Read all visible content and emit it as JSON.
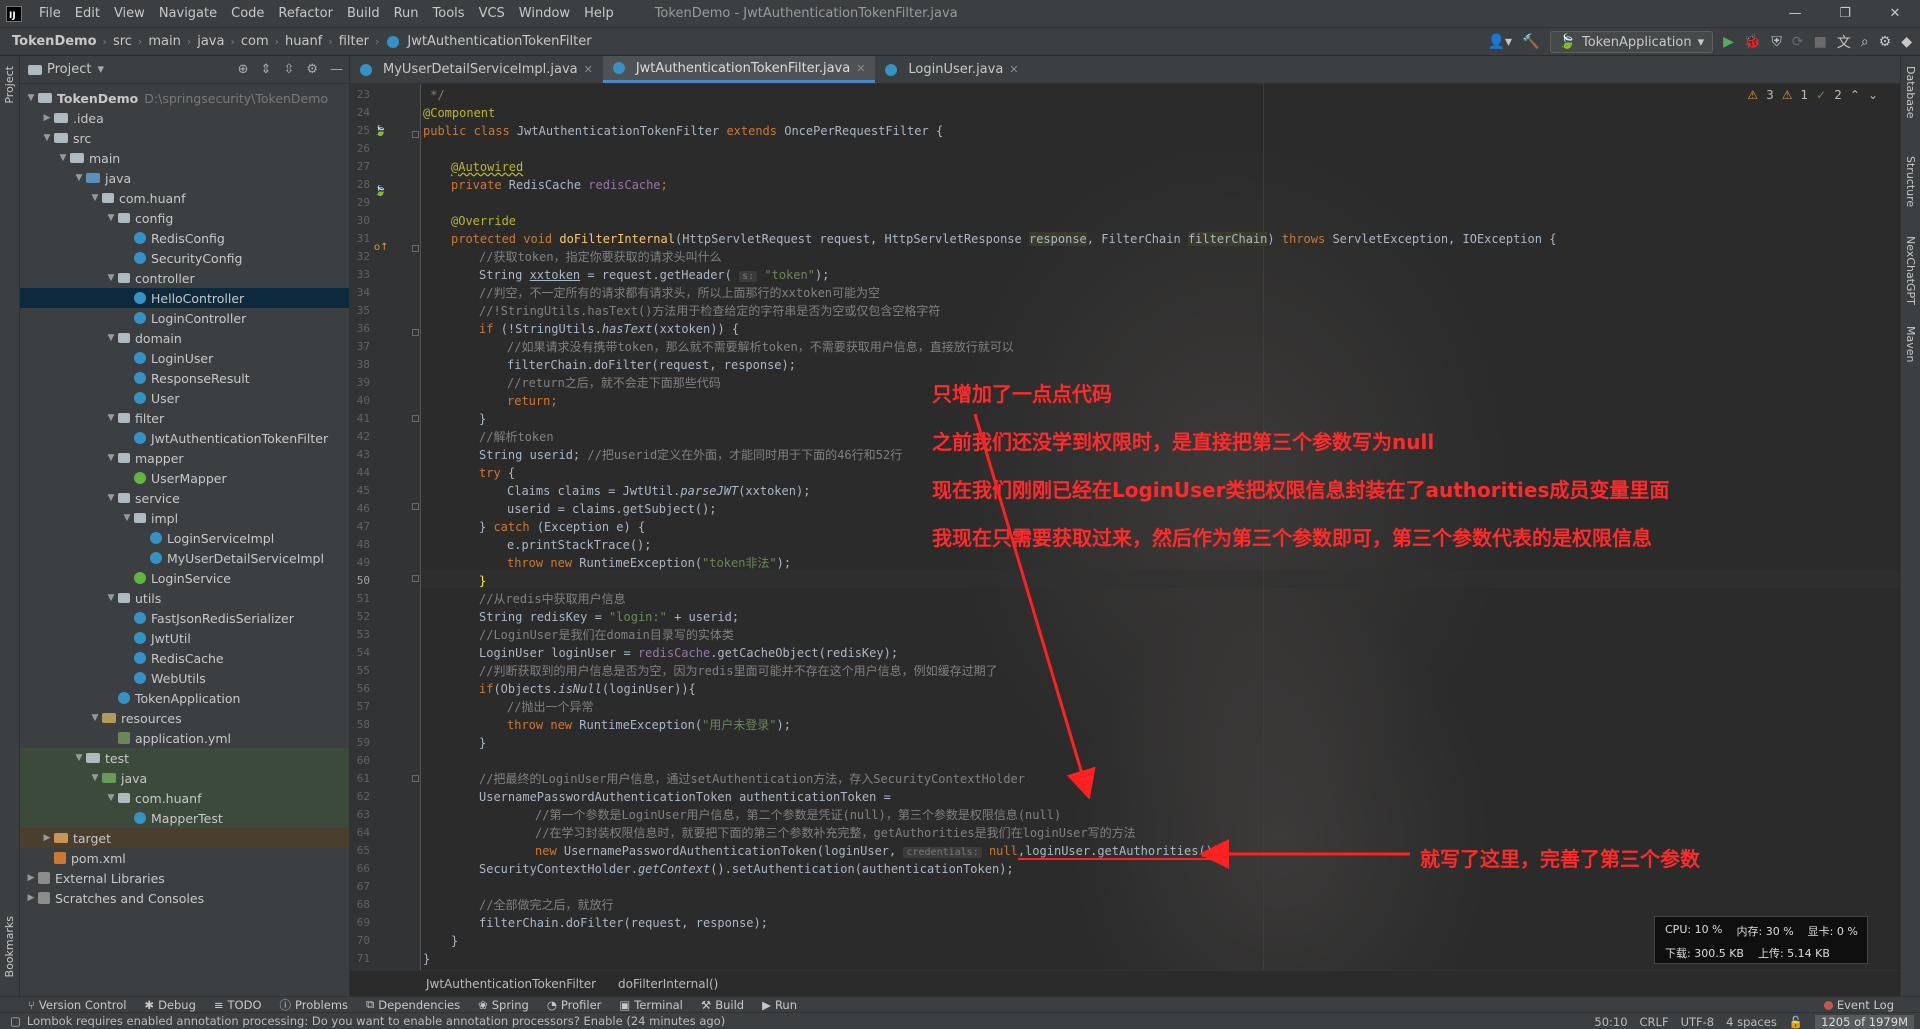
{
  "menubar": {
    "logo": "IJ",
    "items": [
      "File",
      "Edit",
      "View",
      "Navigate",
      "Code",
      "Refactor",
      "Build",
      "Run",
      "Tools",
      "VCS",
      "Window",
      "Help"
    ],
    "window_title": "TokenDemo - JwtAuthenticationTokenFilter.java",
    "controls": [
      "—",
      "❐",
      "✕"
    ]
  },
  "navbar": {
    "crumbs": [
      "TokenDemo",
      "src",
      "main",
      "java",
      "com",
      "huanf",
      "filter",
      "JwtAuthenticationTokenFilter"
    ],
    "run_config": "TokenApplication"
  },
  "left_stripe": {
    "project": "Project",
    "bookmarks": "Bookmarks"
  },
  "right_stripe": [
    "Database",
    "Structure",
    "NexChatGPT",
    "Maven"
  ],
  "project_panel": {
    "title": "Project",
    "tree": [
      {
        "label": "TokenDemo",
        "extra": "D:\\springsecurity\\TokenDemo"
      },
      {
        "label": ".idea"
      },
      {
        "label": "src"
      },
      {
        "label": "main"
      },
      {
        "label": "java"
      },
      {
        "label": "com.huanf"
      },
      {
        "label": "config"
      },
      {
        "label": "RedisConfig"
      },
      {
        "label": "SecurityConfig"
      },
      {
        "label": "controller"
      },
      {
        "label": "HelloController"
      },
      {
        "label": "LoginController"
      },
      {
        "label": "domain"
      },
      {
        "label": "LoginUser"
      },
      {
        "label": "ResponseResult"
      },
      {
        "label": "User"
      },
      {
        "label": "filter"
      },
      {
        "label": "JwtAuthenticationTokenFilter"
      },
      {
        "label": "mapper"
      },
      {
        "label": "UserMapper"
      },
      {
        "label": "service"
      },
      {
        "label": "impl"
      },
      {
        "label": "LoginServiceImpl"
      },
      {
        "label": "MyUserDetailServiceImpl"
      },
      {
        "label": "LoginService"
      },
      {
        "label": "utils"
      },
      {
        "label": "FastJsonRedisSerializer"
      },
      {
        "label": "JwtUtil"
      },
      {
        "label": "RedisCache"
      },
      {
        "label": "WebUtils"
      },
      {
        "label": "TokenApplication"
      },
      {
        "label": "resources"
      },
      {
        "label": "application.yml"
      },
      {
        "label": "test"
      },
      {
        "label": "java"
      },
      {
        "label": "com.huanf"
      },
      {
        "label": "MapperTest"
      },
      {
        "label": "target"
      },
      {
        "label": "pom.xml"
      },
      {
        "label": "External Libraries"
      },
      {
        "label": "Scratches and Consoles"
      }
    ]
  },
  "editor_tabs": [
    {
      "label": "MyUserDetailServiceImpl.java"
    },
    {
      "label": "JwtAuthenticationTokenFilter.java"
    },
    {
      "label": "LoginUser.java"
    }
  ],
  "inspections": {
    "warnings": "3",
    "weak": "1",
    "typos": "2"
  },
  "line_numbers": [
    "23",
    "24",
    "25",
    "26",
    "27",
    "28",
    "29",
    "30",
    "31",
    "32",
    "33",
    "34",
    "35",
    "36",
    "37",
    "38",
    "39",
    "40",
    "41",
    "42",
    "43",
    "44",
    "45",
    "46",
    "47",
    "48",
    "49",
    "50",
    "51",
    "52",
    "53",
    "54",
    "55",
    "56",
    "57",
    "58",
    "59",
    "60",
    "61",
    "62",
    "63",
    "64",
    "65",
    "66",
    "67",
    "68",
    "69",
    "70",
    "71"
  ],
  "code": {
    "l23": " */",
    "l24": "@Component",
    "l25_a": "public class ",
    "l25_b": "JwtAuthenticationTokenFilter ",
    "l25_c": "extends ",
    "l25_d": "OncePerRequestFilter {",
    "l27": "@Autowired",
    "l28_a": "private ",
    "l28_b": "RedisCache ",
    "l28_c": "redisCache",
    "l28_d": ";",
    "l30": "@Override",
    "l31_a": "protected void ",
    "l31_b": "doFilterInternal",
    "l31_c": "(HttpServletRequest request, HttpServletResponse ",
    "l31_d": "response",
    "l31_e": ", FilterChain ",
    "l31_f": "filterChain",
    "l31_g": ") ",
    "l31_h": "throws ",
    "l31_i": "ServletException, IOException {",
    "l32": "//获取token，指定你要获取的请求头叫什么",
    "l33_a": "String ",
    "l33_b": "xxtoken",
    "l33_c": " = request.getHeader( ",
    "l33_hint": "s:",
    "l33_d": " \"token\"",
    "l33_e": ");",
    "l34": "//判空，不一定所有的请求都有请求头，所以上面那行的xxtoken可能为空",
    "l35": "//!StringUtils.hasText()方法用于检查给定的字符串是否为空或仅包含空格字符",
    "l36_a": "if ",
    "l36_b": "(!StringUtils.",
    "l36_c": "hasText",
    "l36_d": "(xxtoken)) {",
    "l37": "//如果请求没有携带token，那么就不需要解析token，不需要获取用户信息，直接放行就可以",
    "l38": "filterChain.doFilter(request, response);",
    "l39": "//return之后，就不会走下面那些代码",
    "l40_a": "return",
    "l40_b": ";",
    "l41": "}",
    "l42": "//解析token",
    "l43_a": "String userid; ",
    "l43_b": "//把userid定义在外面，才能同时用于下面的46行和52行",
    "l44_a": "try ",
    "l44_b": "{",
    "l45_a": "Claims claims = JwtUtil.",
    "l45_b": "parseJWT",
    "l45_c": "(xxtoken);",
    "l46": "userid = claims.getSubject();",
    "l47_a": "} ",
    "l47_b": "catch ",
    "l47_c": "(Exception e) {",
    "l48": "e.printStackTrace();",
    "l49_a": "throw new ",
    "l49_b": "RuntimeException(",
    "l49_c": "\"token非法\"",
    "l49_d": ");",
    "l50": "}",
    "l51": "//从redis中获取用户信息",
    "l52_a": "String redisKey = ",
    "l52_b": "\"login:\"",
    "l52_c": " + userid;",
    "l53": "//LoginUser是我们在domain目录写的实体类",
    "l54_a": "LoginUser loginUser = ",
    "l54_b": "redisCache",
    "l54_c": ".getCacheObject(redisKey);",
    "l55": "//判断获取到的用户信息是否为空，因为redis里面可能并不存在这个用户信息，例如缓存过期了",
    "l56_a": "if",
    "l56_b": "(Objects.",
    "l56_c": "isNull",
    "l56_d": "(loginUser)){",
    "l57": "//抛出一个异常",
    "l58_a": "throw new ",
    "l58_b": "RuntimeException(",
    "l58_c": "\"用户未登录\"",
    "l58_d": ");",
    "l59": "}",
    "l61": "//把最终的LoginUser用户信息，通过setAuthentication方法，存入SecurityContextHolder",
    "l62": "UsernamePasswordAuthenticationToken authenticationToken =",
    "l63": "//第一个参数是LoginUser用户信息，第二个参数是凭证(null)，第三个参数是权限信息(null)",
    "l64": "//在学习封装权限信息时，就要把下面的第三个参数补充完整，getAuthorities是我们在loginUser写的方法",
    "l65_a": "new ",
    "l65_b": "UsernamePasswordAuthenticationToken(loginUser, ",
    "l65_hint": "credentials:",
    "l65_c": " null",
    "l65_d": ",loginUser.getAuthorities());",
    "l66_a": "SecurityContextHolder.",
    "l66_b": "getContext",
    "l66_c": "().setAuthentication(authenticationToken);",
    "l68": "//全部做完之后，就放行",
    "l69": "filterChain.doFilter(request, response);",
    "l70": "}",
    "l71": "}"
  },
  "annotations": {
    "note1": "只增加了一点点代码",
    "note2": "之前我们还没学到权限时，是直接把第三个参数写为null",
    "note3": "现在我们刚刚已经在LoginUser类把权限信息封装在了authorities成员变量里面",
    "note4": "我现在只需要获取过来，然后作为第三个参数即可，第三个参数代表的是权限信息",
    "note5": "就写了这里，完善了第三个参数",
    "arrow_color": "#ff2020"
  },
  "editor_breadcrumb": [
    "JwtAuthenticationTokenFilter",
    "doFilterInternal()"
  ],
  "monitor": {
    "cpu": "CPU: 10 %",
    "mem": "内存: 30 %",
    "gpu": "显卡: 0 %",
    "down": "下载: 300.5 KB",
    "up": "上传: 5.14 KB"
  },
  "tool_windows": [
    "Version Control",
    "Debug",
    "TODO",
    "Problems",
    "Dependencies",
    "Spring",
    "Profiler",
    "Terminal",
    "Build",
    "Run"
  ],
  "event_log": "Event Log",
  "status": {
    "message": "Lombok requires enabled annotation processing: Do you want to enable annotation processors? Enable (24 minutes ago)",
    "position": "50:10",
    "line_sep": "CRLF",
    "encoding": "UTF-8",
    "indent": "4 spaces",
    "memory": "1205 of 1979M"
  },
  "colors": {
    "accent": "#4a88c7",
    "keyword": "#cc7832",
    "string": "#6a8759",
    "annotation": "#bbb529",
    "note_red": "#ff2a2a"
  }
}
